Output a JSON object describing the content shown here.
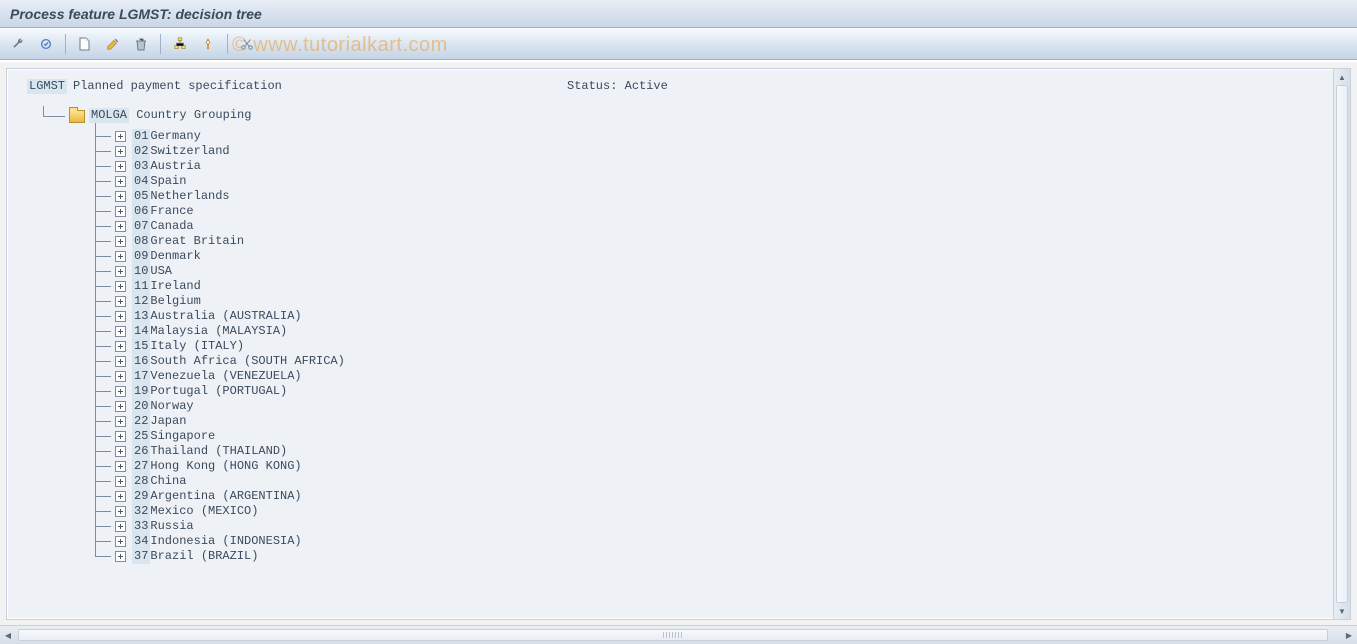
{
  "title": "Process feature LGMST: decision tree",
  "watermark": "© www.tutorialkart.com",
  "toolbar": {
    "icons": [
      "wrench",
      "check-structure",
      "new",
      "edit",
      "delete",
      "structure",
      "slider",
      "cut"
    ]
  },
  "status_label": "Status:",
  "status_value": "Active",
  "tree": {
    "root_code": "LGMST",
    "root_desc": "Planned payment specification",
    "group_code": "MOLGA",
    "group_desc": "Country Grouping",
    "items": [
      {
        "code": "01",
        "name": "Germany"
      },
      {
        "code": "02",
        "name": "Switzerland"
      },
      {
        "code": "03",
        "name": "Austria"
      },
      {
        "code": "04",
        "name": "Spain"
      },
      {
        "code": "05",
        "name": "Netherlands"
      },
      {
        "code": "06",
        "name": "France"
      },
      {
        "code": "07",
        "name": "Canada"
      },
      {
        "code": "08",
        "name": "Great Britain"
      },
      {
        "code": "09",
        "name": "Denmark"
      },
      {
        "code": "10",
        "name": "USA"
      },
      {
        "code": "11",
        "name": "Ireland"
      },
      {
        "code": "12",
        "name": "Belgium"
      },
      {
        "code": "13",
        "name": "Australia (AUSTRALIA)"
      },
      {
        "code": "14",
        "name": "Malaysia (MALAYSIA)"
      },
      {
        "code": "15",
        "name": "Italy (ITALY)"
      },
      {
        "code": "16",
        "name": "South Africa (SOUTH AFRICA)"
      },
      {
        "code": "17",
        "name": "Venezuela (VENEZUELA)"
      },
      {
        "code": "19",
        "name": "Portugal (PORTUGAL)"
      },
      {
        "code": "20",
        "name": "Norway"
      },
      {
        "code": "22",
        "name": "Japan"
      },
      {
        "code": "25",
        "name": "Singapore"
      },
      {
        "code": "26",
        "name": "Thailand (THAILAND)"
      },
      {
        "code": "27",
        "name": "Hong Kong (HONG KONG)"
      },
      {
        "code": "28",
        "name": "China"
      },
      {
        "code": "29",
        "name": "Argentina (ARGENTINA)"
      },
      {
        "code": "32",
        "name": "Mexico (MEXICO)"
      },
      {
        "code": "33",
        "name": "Russia"
      },
      {
        "code": "34",
        "name": "Indonesia (INDONESIA)"
      },
      {
        "code": "37",
        "name": "Brazil (BRAZIL)"
      }
    ]
  }
}
